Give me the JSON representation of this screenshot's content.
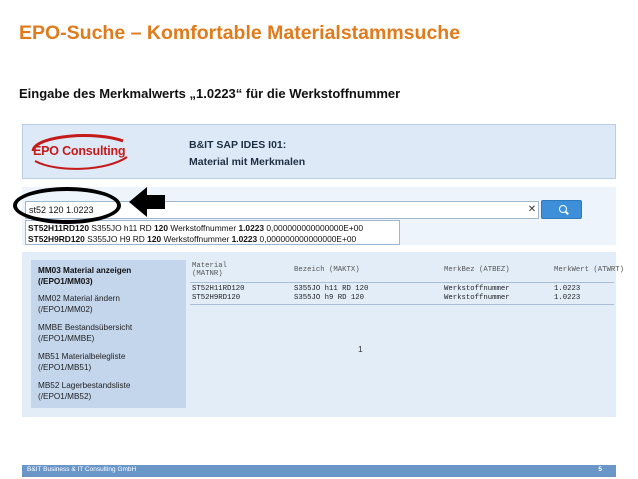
{
  "slide": {
    "title": "EPO-Suche – Komfortable Materialstammsuche",
    "subtitle": "Eingabe des Merkmalwerts „1.0223“ für die Werkstoffnummer"
  },
  "app_header": {
    "logo_text": "EPO Consulting",
    "line1": "B&IT SAP IDES I01:",
    "line2": "Material mit Merkmalen"
  },
  "search": {
    "value": "st52 120 1.0223",
    "clear_glyph": "✕",
    "suggestions": [
      {
        "code": "ST52H11RD120",
        "rest": " S355JO h11 RD ",
        "num": "120",
        "label": " Werkstoffnummer ",
        "value": "1.0223",
        "tail": " 0,000000000000000E+00"
      },
      {
        "code": "ST52H9RD120",
        "rest": " S355JO H9 RD ",
        "num": "120",
        "label": " Werkstoffnummer ",
        "value": "1.0223",
        "tail": " 0,000000000000000E+00"
      }
    ]
  },
  "sidebar": {
    "items": [
      {
        "line1": "MM03 Material anzeigen",
        "line2": "(/EPO1/MM03)",
        "active": true
      },
      {
        "line1": "MM02 Material ändern",
        "line2": "(/EPO1/MM02)",
        "active": false
      },
      {
        "line1": "MMBE Bestandsübersicht",
        "line2": "(/EPO1/MMBE)",
        "active": false
      },
      {
        "line1": "MB51 Materialbelegliste",
        "line2": "(/EPO1/MB51)",
        "active": false
      },
      {
        "line1": "MB52 Lagerbestandsliste",
        "line2": "(/EPO1/MB52)",
        "active": false
      }
    ]
  },
  "table": {
    "columns": [
      {
        "label": "Material",
        "sub": "(MATNR)"
      },
      {
        "label": "Bezeich (MAKTX)",
        "sub": ""
      },
      {
        "label": "MerkBez (ATBEZ)",
        "sub": ""
      },
      {
        "label": "MerkWert (ATWRT)",
        "sub": ""
      }
    ],
    "rows": [
      [
        "ST52H11RD120",
        "S355JO h11 RD 120",
        "Werkstoffnummer",
        "1.0223"
      ],
      [
        "ST52H9RD120",
        "S355JO h9 RD 120",
        "Werkstoffnummer",
        "1.0223"
      ]
    ],
    "page": "1"
  },
  "footer": {
    "text": "B&IT Business & IT Consulting GmbH",
    "page_number": "5"
  },
  "colors": {
    "title": "#e07b1c",
    "header_bg": "#dde9f6",
    "sidebar_bg": "#c4d6ec",
    "search_button": "#3c8fd8",
    "footer_bar": "#6a96c8",
    "logo_red": "#c41a1a"
  }
}
